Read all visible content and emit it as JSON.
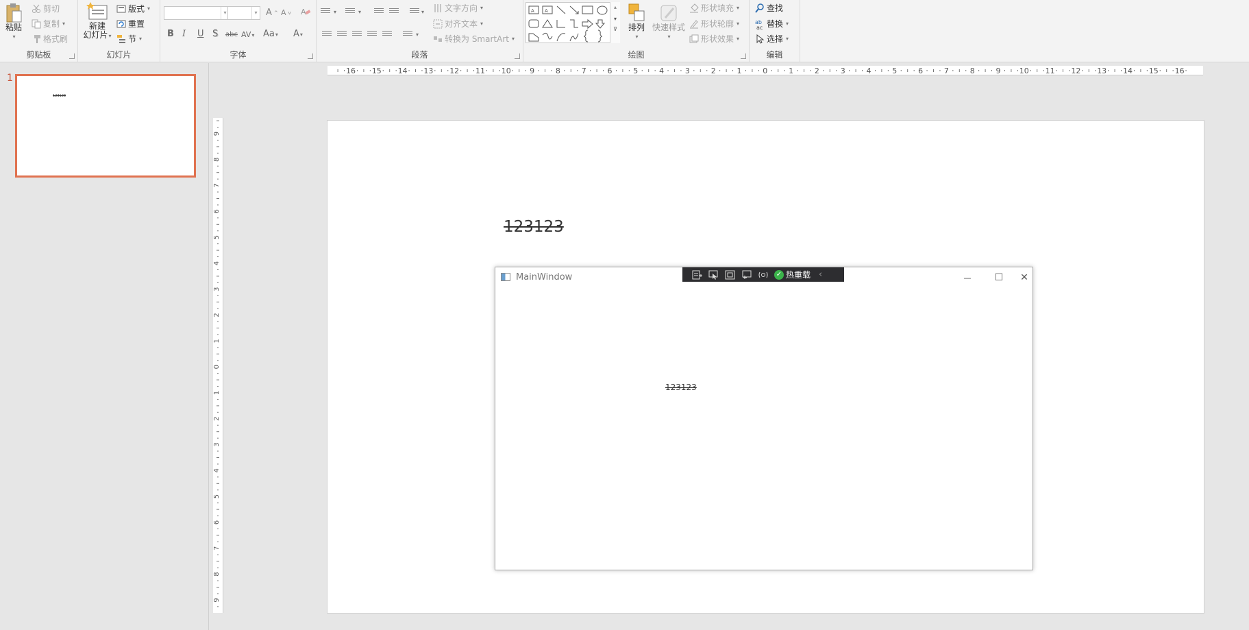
{
  "ribbon": {
    "clipboard": {
      "paste": "粘贴",
      "cut": "剪切",
      "copy": "复制",
      "format_painter": "格式刷",
      "label": "剪贴板"
    },
    "slides": {
      "new_slide_line1": "新建",
      "new_slide_line2": "幻灯片",
      "layout": "版式",
      "reset": "重置",
      "section": "节",
      "label": "幻灯片"
    },
    "font": {
      "font_name": "",
      "font_size": "",
      "bold": "B",
      "italic": "I",
      "underline": "U",
      "shadow": "S",
      "strike": "abc",
      "spacing": "AV",
      "case": "Aa",
      "color": "A",
      "grow": "A",
      "shrink": "A",
      "label": "字体"
    },
    "paragraph": {
      "text_direction": "文字方向",
      "align_text": "对齐文本",
      "smartart": "转换为 SmartArt",
      "label": "段落"
    },
    "drawing": {
      "arrange": "排列",
      "quick_styles": "快速样式",
      "shape_fill": "形状填充",
      "shape_outline": "形状轮廓",
      "shape_effects": "形状效果",
      "label": "绘图"
    },
    "editing": {
      "find": "查找",
      "replace": "替换",
      "select": "选择",
      "label": "编辑"
    }
  },
  "thumbnails": {
    "slide_number": "1",
    "slide_text": "123123"
  },
  "ruler_h": [
    "16",
    "15",
    "14",
    "13",
    "12",
    "11",
    "10",
    "9",
    "8",
    "7",
    "6",
    "5",
    "4",
    "3",
    "2",
    "1",
    "0",
    "1",
    "2",
    "3",
    "4",
    "5",
    "6",
    "7",
    "8",
    "9",
    "10",
    "11",
    "12",
    "13",
    "14",
    "15",
    "16"
  ],
  "ruler_v": [
    "9",
    "8",
    "7",
    "6",
    "5",
    "4",
    "3",
    "2",
    "1",
    "0",
    "1",
    "2",
    "3",
    "4",
    "5",
    "6",
    "7",
    "8",
    "9"
  ],
  "slide": {
    "text": "123123"
  },
  "main_window": {
    "title": "MainWindow",
    "body_text": "123123",
    "minimize": "—",
    "maximize": "☐",
    "close": "✕",
    "toolbar_hot_reload": "热重载",
    "toolbar_collapse": "‹"
  },
  "colors": {
    "accent": "#e07250",
    "debug_bar": "#2d2d30",
    "hot_reload_ok": "#3bb34a"
  }
}
